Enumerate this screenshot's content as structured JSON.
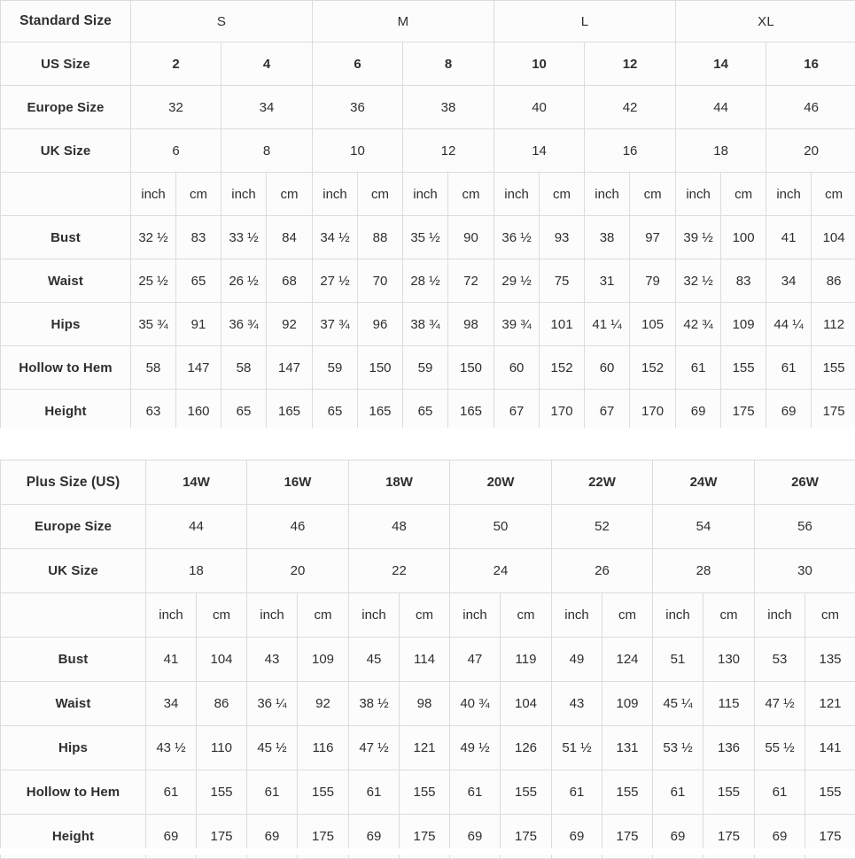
{
  "standard_table": {
    "label_column": {
      "header": "Standard Size",
      "rows": [
        "US Size",
        "Europe Size",
        "UK Size",
        "",
        "Bust",
        "Waist",
        "Hips",
        "Hollow to Hem",
        "Height"
      ]
    },
    "size_groups": [
      {
        "label": "S",
        "span": 2
      },
      {
        "label": "M",
        "span": 2
      },
      {
        "label": "L",
        "span": 2
      },
      {
        "label": "XL",
        "span": 2
      }
    ],
    "us_size": [
      "2",
      "4",
      "6",
      "8",
      "10",
      "12",
      "14",
      "16"
    ],
    "europe_size": [
      "32",
      "34",
      "36",
      "38",
      "40",
      "42",
      "44",
      "46"
    ],
    "uk_size": [
      "6",
      "8",
      "10",
      "12",
      "14",
      "16",
      "18",
      "20"
    ],
    "units": [
      "inch",
      "cm",
      "inch",
      "cm",
      "inch",
      "cm",
      "inch",
      "cm",
      "inch",
      "cm",
      "inch",
      "cm",
      "inch",
      "cm",
      "inch",
      "cm"
    ],
    "bust": [
      "32 ½",
      "83",
      "33 ½",
      "84",
      "34 ½",
      "88",
      "35 ½",
      "90",
      "36 ½",
      "93",
      "38",
      "97",
      "39 ½",
      "100",
      "41",
      "104"
    ],
    "waist": [
      "25 ½",
      "65",
      "26 ½",
      "68",
      "27 ½",
      "70",
      "28 ½",
      "72",
      "29 ½",
      "75",
      "31",
      "79",
      "32 ½",
      "83",
      "34",
      "86"
    ],
    "hips": [
      "35 ¾",
      "91",
      "36 ¾",
      "92",
      "37 ¾",
      "96",
      "38 ¾",
      "98",
      "39 ¾",
      "101",
      "41 ¼",
      "105",
      "42 ¾",
      "109",
      "44 ¼",
      "112"
    ],
    "hollow_to_hem": [
      "58",
      "147",
      "58",
      "147",
      "59",
      "150",
      "59",
      "150",
      "60",
      "152",
      "60",
      "152",
      "61",
      "155",
      "61",
      "155"
    ],
    "height": [
      "63",
      "160",
      "65",
      "165",
      "65",
      "165",
      "65",
      "165",
      "67",
      "170",
      "67",
      "170",
      "69",
      "175",
      "69",
      "175"
    ]
  },
  "plus_table": {
    "label_column": {
      "header": "Plus Size (US)",
      "rows": [
        "Europe Size",
        "UK Size",
        "",
        "Bust",
        "Waist",
        "Hips",
        "Hollow to Hem",
        "Height"
      ]
    },
    "plus_sizes": [
      "14W",
      "16W",
      "18W",
      "20W",
      "22W",
      "24W",
      "26W"
    ],
    "europe_size": [
      "44",
      "46",
      "48",
      "50",
      "52",
      "54",
      "56"
    ],
    "uk_size": [
      "18",
      "20",
      "22",
      "24",
      "26",
      "28",
      "30"
    ],
    "units": [
      "inch",
      "cm",
      "inch",
      "cm",
      "inch",
      "cm",
      "inch",
      "cm",
      "inch",
      "cm",
      "inch",
      "cm",
      "inch",
      "cm"
    ],
    "bust": [
      "41",
      "104",
      "43",
      "109",
      "45",
      "114",
      "47",
      "119",
      "49",
      "124",
      "51",
      "130",
      "53",
      "135"
    ],
    "waist": [
      "34",
      "86",
      "36 ¼",
      "92",
      "38 ½",
      "98",
      "40 ¾",
      "104",
      "43",
      "109",
      "45 ¼",
      "115",
      "47 ½",
      "121"
    ],
    "hips": [
      "43 ½",
      "110",
      "45 ½",
      "116",
      "47 ½",
      "121",
      "49 ½",
      "126",
      "51 ½",
      "131",
      "53 ½",
      "136",
      "55 ½",
      "141"
    ],
    "hollow_to_hem": [
      "61",
      "155",
      "61",
      "155",
      "61",
      "155",
      "61",
      "155",
      "61",
      "155",
      "61",
      "155",
      "61",
      "155"
    ],
    "height": [
      "69",
      "175",
      "69",
      "175",
      "69",
      "175",
      "69",
      "175",
      "69",
      "175",
      "69",
      "175",
      "69",
      "175"
    ]
  },
  "colors": {
    "label_background": "#ffff00",
    "label_text": "#4a3c0c",
    "group_header_background": "#0ff0fc",
    "group_header_text": "#2a5f63",
    "cell_background": "#fcfcfc",
    "cell_border": "#dcdcdc",
    "cell_text": "#2f2f2f"
  }
}
